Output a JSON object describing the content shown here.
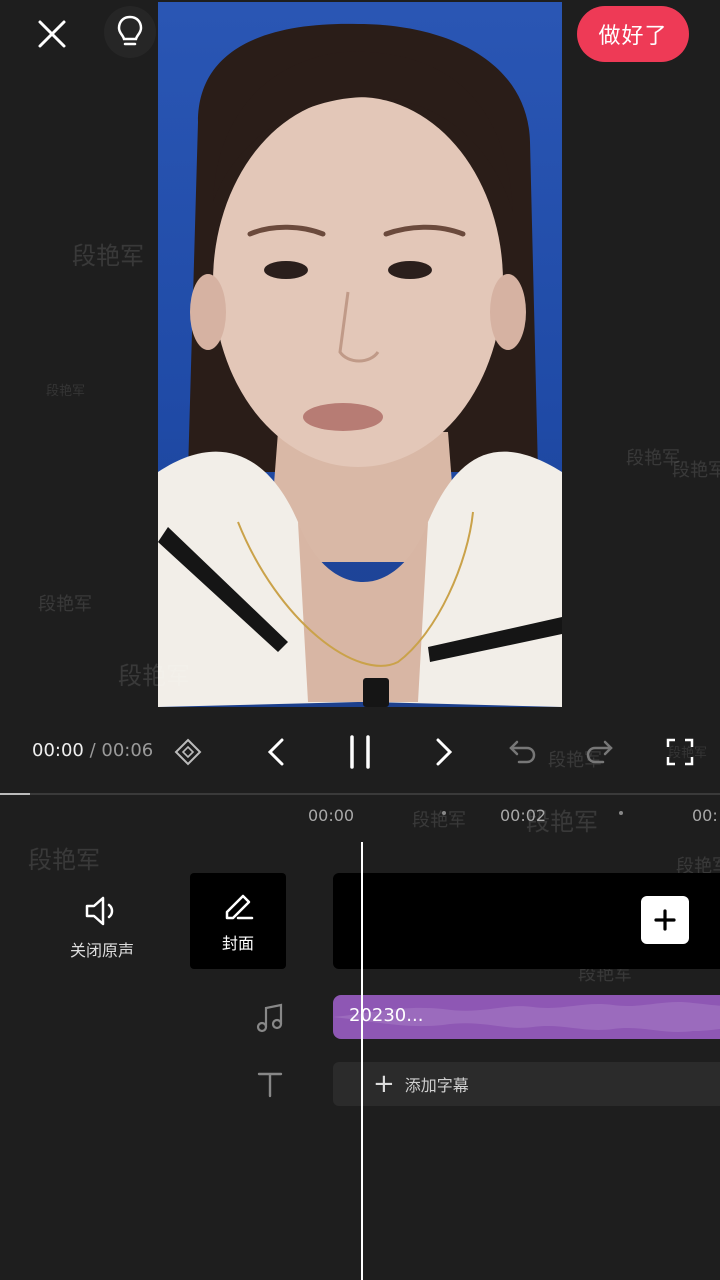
{
  "topbar": {
    "done_label": "做好了"
  },
  "player": {
    "time_current": "00:00",
    "time_separator": " / ",
    "time_total": "00:06",
    "progress": 0.0
  },
  "timeline": {
    "ticks": [
      "00:00",
      "00:02",
      "00:"
    ],
    "mute_label": "关闭原声",
    "cover_label": "封面",
    "audio_clip_label": "20230...",
    "add_subtitle_label": "添加字幕"
  },
  "watermarks": [
    "段艳军"
  ],
  "icons": {
    "close": "close-icon",
    "tip": "lightbulb-icon",
    "keyframe": "keyframe-icon",
    "prev": "chevron-left-icon",
    "pause": "pause-icon",
    "next": "chevron-right-icon",
    "undo": "undo-icon",
    "redo": "redo-icon",
    "fullscreen": "fullscreen-icon",
    "speaker": "speaker-icon",
    "edit": "pencil-icon",
    "add": "plus-icon",
    "music": "music-note-icon",
    "text": "text-icon"
  },
  "colors": {
    "accent": "#ee3a56",
    "audio_track": "#8e57b4",
    "background": "#1e1e1e"
  }
}
